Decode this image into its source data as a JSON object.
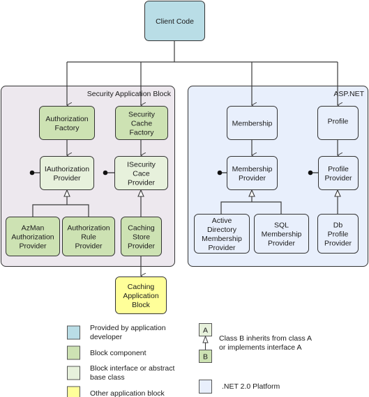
{
  "colors": {
    "developer": "#b9dde6",
    "block_component": "#cde2b3",
    "block_interface": "#e7f1dc",
    "other_block": "#ffff99",
    "platform": "#e8effc",
    "security_container": "#ede8ee",
    "stroke": "#333333"
  },
  "nodes": {
    "client_code": [
      "Client Code"
    ],
    "authorization_factory": [
      "Authorization",
      "Factory"
    ],
    "security_cache_factory": [
      "Security",
      "Cache",
      "Factory"
    ],
    "iauthorization_provider": [
      "IAuthorization",
      "Provider"
    ],
    "isecurity_cache_provider": [
      "ISecurity",
      "Cace",
      "Provider"
    ],
    "azman_provider": [
      "AzMan",
      "Authorization",
      "Provider"
    ],
    "authorization_rule_provider": [
      "Authorization",
      "Rule",
      "Provider"
    ],
    "caching_store_provider": [
      "Caching",
      "Store",
      "Provider"
    ],
    "caching_application_block": [
      "Caching",
      "Application",
      "Block"
    ],
    "membership": [
      "Membership"
    ],
    "profile": [
      "Profile"
    ],
    "membership_provider": [
      "Membership",
      "Provider"
    ],
    "profile_provider": [
      "Profile",
      "Provider"
    ],
    "active_directory_provider": [
      "Active",
      "Directory",
      "Membership",
      "Provider"
    ],
    "sql_membership_provider": [
      "SQL",
      "Membership",
      "Provider"
    ],
    "db_profile_provider": [
      "Db",
      "Profile",
      "Provider"
    ]
  },
  "containers": {
    "security": "Security Application Block",
    "aspnet": "ASP.NET"
  },
  "legend": {
    "developer": [
      "Provided by application",
      "developer"
    ],
    "block_component": [
      "Block component"
    ],
    "block_interface": [
      "Block interface or abstract",
      "base class"
    ],
    "other_block": [
      "Other application block"
    ],
    "inherit_a": "A",
    "inherit_b": "B",
    "inherit_text": [
      "Class B inherits from class A",
      "or implements interface A"
    ],
    "platform": [
      ".NET 2.0 Platform"
    ]
  }
}
